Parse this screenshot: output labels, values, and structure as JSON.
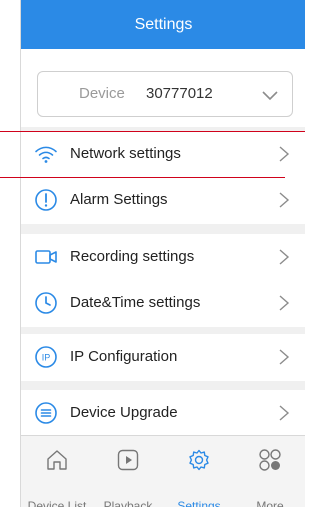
{
  "header": {
    "title": "Settings"
  },
  "device": {
    "label": "Device",
    "id": "30777012"
  },
  "rows": [
    {
      "label": "Network settings",
      "icon": "wifi-icon"
    },
    {
      "label": "Alarm Settings",
      "icon": "alarm-icon"
    },
    {
      "label": "Recording settings",
      "icon": "video-camera-icon"
    },
    {
      "label": "Date&Time settings",
      "icon": "clock-icon"
    },
    {
      "label": "IP Configuration",
      "icon": "ip-icon"
    },
    {
      "label": "Device Upgrade",
      "icon": "upgrade-icon"
    }
  ],
  "tabs": [
    {
      "label": "Device List",
      "icon": "home-icon"
    },
    {
      "label": "Playback",
      "icon": "playback-icon"
    },
    {
      "label": "Settings",
      "icon": "gear-icon",
      "active": true
    },
    {
      "label": "More",
      "icon": "more-icon"
    }
  ],
  "colors": {
    "accent": "#2b8ae6",
    "highlight": "#d0021b"
  }
}
